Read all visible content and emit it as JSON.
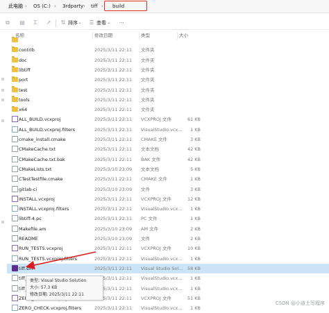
{
  "breadcrumb": {
    "items": [
      "此电脑",
      "OS (C:)",
      "3rdparty",
      "tiff",
      "build"
    ],
    "separator": "›"
  },
  "toolbar": {
    "sort_label": "排序",
    "view_label": "查看",
    "more_label": "···"
  },
  "columns": {
    "name": "名称",
    "date": "修改日期",
    "type": "类型",
    "size": "大小"
  },
  "rows": [
    {
      "name": "",
      "date": "",
      "type": "",
      "size": "",
      "kind": "folder",
      "partial": true
    },
    {
      "name": "contrib",
      "date": "2025/3/11 22:11",
      "type": "文件夹",
      "size": "",
      "kind": "folder"
    },
    {
      "name": "doc",
      "date": "2025/3/11 22:11",
      "type": "文件夹",
      "size": "",
      "kind": "folder"
    },
    {
      "name": "libtiff",
      "date": "2025/3/11 22:11",
      "type": "文件夹",
      "size": "",
      "kind": "folder"
    },
    {
      "name": "port",
      "date": "2025/3/11 22:11",
      "type": "文件夹",
      "size": "",
      "kind": "folder"
    },
    {
      "name": "test",
      "date": "2025/3/11 22:11",
      "type": "文件夹",
      "size": "",
      "kind": "folder"
    },
    {
      "name": "tools",
      "date": "2025/3/11 22:11",
      "type": "文件夹",
      "size": "",
      "kind": "folder"
    },
    {
      "name": "x64",
      "date": "2025/3/11 22:11",
      "type": "文件夹",
      "size": "",
      "kind": "folder"
    },
    {
      "name": "ALL_BUILD.vcxproj",
      "date": "2025/3/11 22:11",
      "type": "VCXPROJ 文件",
      "size": "61 KB",
      "kind": "vs"
    },
    {
      "name": "ALL_BUILD.vcxproj.filters",
      "date": "2025/3/11 22:11",
      "type": "VisualStudio.vcx...",
      "size": "1 KB",
      "kind": "filters"
    },
    {
      "name": "cmake_install.cmake",
      "date": "2025/3/11 22:11",
      "type": "CMAKE 文件",
      "size": "3 KB",
      "kind": "file"
    },
    {
      "name": "CMakeCache.txt",
      "date": "2025/3/11 22:11",
      "type": "文本文档",
      "size": "42 KB",
      "kind": "file"
    },
    {
      "name": "CMakeCache.txt.bak",
      "date": "2025/3/11 22:11",
      "type": "BAK 文件",
      "size": "42 KB",
      "kind": "file"
    },
    {
      "name": "CMakeLists.txt",
      "date": "2025/3/10 23:09",
      "type": "文本文档",
      "size": "5 KB",
      "kind": "file"
    },
    {
      "name": "CTestTestfile.cmake",
      "date": "2025/3/11 22:11",
      "type": "CMAKE 文件",
      "size": "1 KB",
      "kind": "file"
    },
    {
      "name": "gitlab-ci",
      "date": "2025/3/10 23:09",
      "type": "文件",
      "size": "3 KB",
      "kind": "file"
    },
    {
      "name": "INSTALL.vcxproj",
      "date": "2025/3/11 22:11",
      "type": "VCXPROJ 文件",
      "size": "12 KB",
      "kind": "vs"
    },
    {
      "name": "INSTALL.vcxproj.filters",
      "date": "2025/3/11 22:11",
      "type": "VisualStudio.vcx...",
      "size": "1 KB",
      "kind": "filters"
    },
    {
      "name": "libtiff-4.pc",
      "date": "2025/3/11 22:11",
      "type": "PC 文件",
      "size": "1 KB",
      "kind": "file"
    },
    {
      "name": "Makefile.am",
      "date": "2025/3/10 23:09",
      "type": "AM 文件",
      "size": "2 KB",
      "kind": "file"
    },
    {
      "name": "README",
      "date": "2025/3/10 23:09",
      "type": "文件",
      "size": "2 KB",
      "kind": "file"
    },
    {
      "name": "RUN_TESTS.vcxproj",
      "date": "2025/3/11 22:11",
      "type": "VCXPROJ 文件",
      "size": "10 KB",
      "kind": "vs"
    },
    {
      "name": "RUN_TESTS.vcxproj.filters",
      "date": "2025/3/11 22:11",
      "type": "VisualStudio.vcx...",
      "size": "1 KB",
      "kind": "filters"
    },
    {
      "name": "tiff.sln",
      "date": "2025/3/11 22:11",
      "type": "Visual Studio Sol...",
      "size": "58 KB",
      "kind": "sln",
      "selected": true
    },
    {
      "name": "tiff_rel",
      "date": "2025/3/11 22:11",
      "type": "VisualStudio.vcx...",
      "size": "1 KB",
      "kind": "file"
    },
    {
      "name": "tiff_rel",
      "date": "2025/3/11 22:11",
      "type": "VisualStudio.vcx...",
      "size": "1 KB",
      "kind": "file"
    },
    {
      "name": "ZERO_CHECK.vcxproj",
      "date": "2025/3/11 22:11",
      "type": "VCXPROJ 文件",
      "size": "51 KB",
      "kind": "vs"
    },
    {
      "name": "ZERO_CHECK.vcxproj.filters",
      "date": "2025/3/11 22:11",
      "type": "VisualStudio.vcx...",
      "size": "1 KB",
      "kind": "filters",
      "partial": true
    }
  ],
  "tooltip": {
    "type_line": "类型: Visual Studio Solution",
    "size_line": "大小: 57.3 KB",
    "date_line": "修改日期: 2025/3/11 22:11"
  },
  "watermark": "CSDN @小道士写程序",
  "colors": {
    "highlight_box": "#e0301e",
    "selection": "#cce4f7",
    "arrow": "#d81e1e",
    "folder": "#f0c040",
    "sln": "#5c2d91"
  }
}
